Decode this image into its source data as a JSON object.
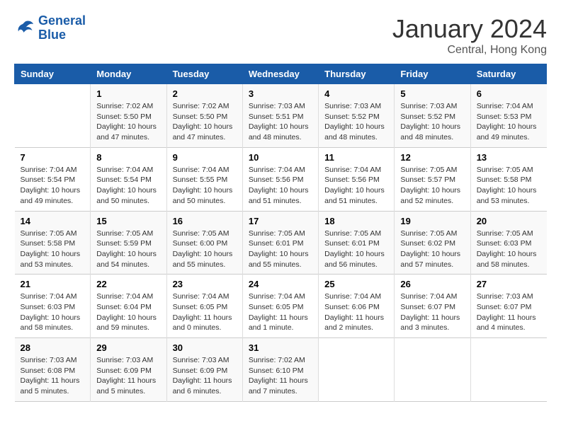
{
  "header": {
    "logo_line1": "General",
    "logo_line2": "Blue",
    "month": "January 2024",
    "location": "Central, Hong Kong"
  },
  "weekdays": [
    "Sunday",
    "Monday",
    "Tuesday",
    "Wednesday",
    "Thursday",
    "Friday",
    "Saturday"
  ],
  "weeks": [
    [
      {
        "day": "",
        "info": ""
      },
      {
        "day": "1",
        "info": "Sunrise: 7:02 AM\nSunset: 5:50 PM\nDaylight: 10 hours and 47 minutes."
      },
      {
        "day": "2",
        "info": "Sunrise: 7:02 AM\nSunset: 5:50 PM\nDaylight: 10 hours and 47 minutes."
      },
      {
        "day": "3",
        "info": "Sunrise: 7:03 AM\nSunset: 5:51 PM\nDaylight: 10 hours and 48 minutes."
      },
      {
        "day": "4",
        "info": "Sunrise: 7:03 AM\nSunset: 5:52 PM\nDaylight: 10 hours and 48 minutes."
      },
      {
        "day": "5",
        "info": "Sunrise: 7:03 AM\nSunset: 5:52 PM\nDaylight: 10 hours and 48 minutes."
      },
      {
        "day": "6",
        "info": "Sunrise: 7:04 AM\nSunset: 5:53 PM\nDaylight: 10 hours and 49 minutes."
      }
    ],
    [
      {
        "day": "7",
        "info": "Sunrise: 7:04 AM\nSunset: 5:54 PM\nDaylight: 10 hours and 49 minutes."
      },
      {
        "day": "8",
        "info": "Sunrise: 7:04 AM\nSunset: 5:54 PM\nDaylight: 10 hours and 50 minutes."
      },
      {
        "day": "9",
        "info": "Sunrise: 7:04 AM\nSunset: 5:55 PM\nDaylight: 10 hours and 50 minutes."
      },
      {
        "day": "10",
        "info": "Sunrise: 7:04 AM\nSunset: 5:56 PM\nDaylight: 10 hours and 51 minutes."
      },
      {
        "day": "11",
        "info": "Sunrise: 7:04 AM\nSunset: 5:56 PM\nDaylight: 10 hours and 51 minutes."
      },
      {
        "day": "12",
        "info": "Sunrise: 7:05 AM\nSunset: 5:57 PM\nDaylight: 10 hours and 52 minutes."
      },
      {
        "day": "13",
        "info": "Sunrise: 7:05 AM\nSunset: 5:58 PM\nDaylight: 10 hours and 53 minutes."
      }
    ],
    [
      {
        "day": "14",
        "info": "Sunrise: 7:05 AM\nSunset: 5:58 PM\nDaylight: 10 hours and 53 minutes."
      },
      {
        "day": "15",
        "info": "Sunrise: 7:05 AM\nSunset: 5:59 PM\nDaylight: 10 hours and 54 minutes."
      },
      {
        "day": "16",
        "info": "Sunrise: 7:05 AM\nSunset: 6:00 PM\nDaylight: 10 hours and 55 minutes."
      },
      {
        "day": "17",
        "info": "Sunrise: 7:05 AM\nSunset: 6:01 PM\nDaylight: 10 hours and 55 minutes."
      },
      {
        "day": "18",
        "info": "Sunrise: 7:05 AM\nSunset: 6:01 PM\nDaylight: 10 hours and 56 minutes."
      },
      {
        "day": "19",
        "info": "Sunrise: 7:05 AM\nSunset: 6:02 PM\nDaylight: 10 hours and 57 minutes."
      },
      {
        "day": "20",
        "info": "Sunrise: 7:05 AM\nSunset: 6:03 PM\nDaylight: 10 hours and 58 minutes."
      }
    ],
    [
      {
        "day": "21",
        "info": "Sunrise: 7:04 AM\nSunset: 6:03 PM\nDaylight: 10 hours and 58 minutes."
      },
      {
        "day": "22",
        "info": "Sunrise: 7:04 AM\nSunset: 6:04 PM\nDaylight: 10 hours and 59 minutes."
      },
      {
        "day": "23",
        "info": "Sunrise: 7:04 AM\nSunset: 6:05 PM\nDaylight: 11 hours and 0 minutes."
      },
      {
        "day": "24",
        "info": "Sunrise: 7:04 AM\nSunset: 6:05 PM\nDaylight: 11 hours and 1 minute."
      },
      {
        "day": "25",
        "info": "Sunrise: 7:04 AM\nSunset: 6:06 PM\nDaylight: 11 hours and 2 minutes."
      },
      {
        "day": "26",
        "info": "Sunrise: 7:04 AM\nSunset: 6:07 PM\nDaylight: 11 hours and 3 minutes."
      },
      {
        "day": "27",
        "info": "Sunrise: 7:03 AM\nSunset: 6:07 PM\nDaylight: 11 hours and 4 minutes."
      }
    ],
    [
      {
        "day": "28",
        "info": "Sunrise: 7:03 AM\nSunset: 6:08 PM\nDaylight: 11 hours and 5 minutes."
      },
      {
        "day": "29",
        "info": "Sunrise: 7:03 AM\nSunset: 6:09 PM\nDaylight: 11 hours and 5 minutes."
      },
      {
        "day": "30",
        "info": "Sunrise: 7:03 AM\nSunset: 6:09 PM\nDaylight: 11 hours and 6 minutes."
      },
      {
        "day": "31",
        "info": "Sunrise: 7:02 AM\nSunset: 6:10 PM\nDaylight: 11 hours and 7 minutes."
      },
      {
        "day": "",
        "info": ""
      },
      {
        "day": "",
        "info": ""
      },
      {
        "day": "",
        "info": ""
      }
    ]
  ]
}
